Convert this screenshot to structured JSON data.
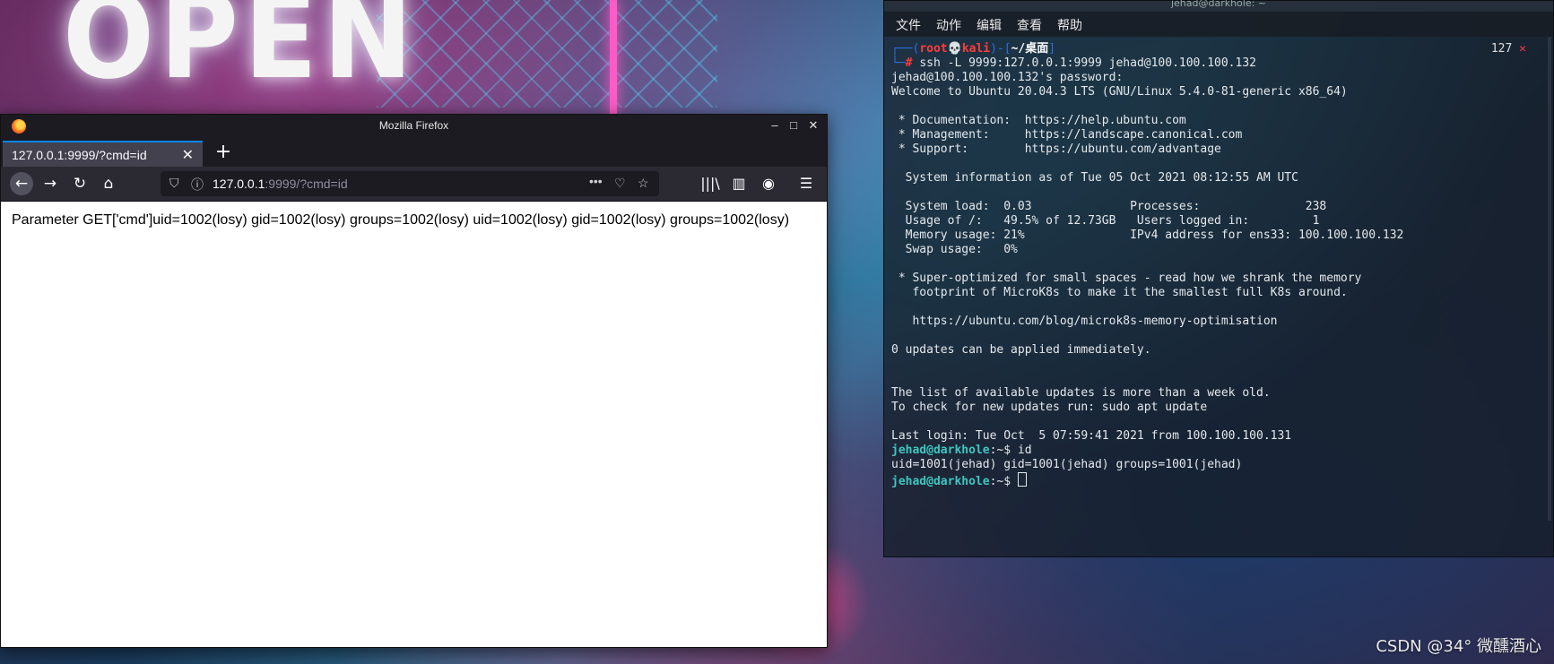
{
  "desktop": {
    "neon_text": "OPEN",
    "watermark": "CSDN @34° 微醺酒心"
  },
  "firefox": {
    "window_title": "Mozilla Firefox",
    "tab_label": "127.0.0.1:9999/?cmd=id",
    "tab_close": "✕",
    "new_tab": "+",
    "url_host": "127.0.0.1",
    "url_rest": ":9999/?cmd=id",
    "page_text": "Parameter GET['cmd']uid=1002(losy) gid=1002(losy) groups=1002(losy) uid=1002(losy) gid=1002(losy) groups=1002(losy)",
    "controls": {
      "minimize": "–",
      "maximize": "□",
      "close": "✕"
    },
    "icons": {
      "back": "←",
      "forward": "→",
      "reload": "↻",
      "home": "⌂",
      "more": "•••",
      "pocket": "♡",
      "star": "☆",
      "library": "|||\\",
      "sidebar": "▥",
      "account": "◉",
      "menu": "☰",
      "shield": "⛉",
      "info": "ⓘ"
    }
  },
  "terminal": {
    "window_title": "jehad@darkhole: ~",
    "menu": [
      "文件",
      "动作",
      "编辑",
      "查看",
      "帮助"
    ],
    "prompt": {
      "open": "┌──(",
      "user": "root",
      "skull": "💀",
      "host": "kali",
      "mid": ")-[",
      "dir": "~/桌面",
      "close": "]",
      "line2": "└─",
      "hash": "# "
    },
    "command": "ssh -L 9999:127.0.0.1:9999 jehad@100.100.100.132",
    "exit_code": "127",
    "exit_mark": "✕",
    "output_lines": [
      "jehad@100.100.100.132's password:",
      "Welcome to Ubuntu 20.04.3 LTS (GNU/Linux 5.4.0-81-generic x86_64)",
      "",
      " * Documentation:  https://help.ubuntu.com",
      " * Management:     https://landscape.canonical.com",
      " * Support:        https://ubuntu.com/advantage",
      "",
      "  System information as of Tue 05 Oct 2021 08:12:55 AM UTC",
      "",
      "  System load:  0.03              Processes:               238",
      "  Usage of /:   49.5% of 12.73GB   Users logged in:         1",
      "  Memory usage: 21%               IPv4 address for ens33: 100.100.100.132",
      "  Swap usage:   0%",
      "",
      " * Super-optimized for small spaces - read how we shrank the memory",
      "   footprint of MicroK8s to make it the smallest full K8s around.",
      "",
      "   https://ubuntu.com/blog/microk8s-memory-optimisation",
      "",
      "0 updates can be applied immediately.",
      "",
      "",
      "The list of available updates is more than a week old.",
      "To check for new updates run: sudo apt update",
      "",
      "Last login: Tue Oct  5 07:59:41 2021 from 100.100.100.131"
    ],
    "remote_prompt_user": "jehad@darkhole",
    "remote_prompt_rest": ":~$ ",
    "cmd_id": "id",
    "id_output": "uid=1001(jehad) gid=1001(jehad) groups=1001(jehad)"
  }
}
